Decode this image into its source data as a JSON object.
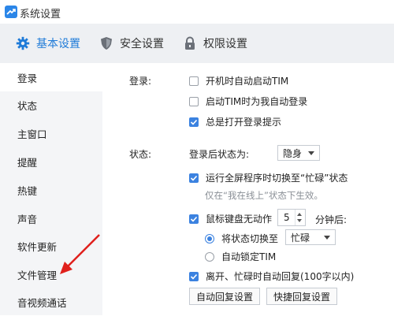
{
  "window": {
    "title": "系统设置"
  },
  "tabs": [
    {
      "label": "基本设置",
      "icon": "gear-icon",
      "active": true
    },
    {
      "label": "安全设置",
      "icon": "shield-icon",
      "active": false
    },
    {
      "label": "权限设置",
      "icon": "lock-icon",
      "active": false
    }
  ],
  "sidebar": {
    "items": [
      {
        "label": "登录",
        "active": true
      },
      {
        "label": "状态"
      },
      {
        "label": "主窗口"
      },
      {
        "label": "提醒"
      },
      {
        "label": "热键"
      },
      {
        "label": "声音"
      },
      {
        "label": "软件更新"
      },
      {
        "label": "文件管理"
      },
      {
        "label": "音视频通话"
      }
    ]
  },
  "login": {
    "label": "登录:",
    "options": [
      {
        "label": "开机时自动启动TIM",
        "checked": false
      },
      {
        "label": "启动TIM时为我自动登录",
        "checked": false
      },
      {
        "label": "总是打开登录提示",
        "checked": true
      }
    ]
  },
  "status": {
    "label": "状态:",
    "after_login_label": "登录后状态为:",
    "after_login_value": "隐身",
    "fullscreen_option": {
      "label": "运行全屏程序时切换至“忙碌”状态",
      "checked": true
    },
    "fullscreen_note": "仅在“我在线上”状态下生效。",
    "idle_option": {
      "label": "鼠标键盘无动作",
      "checked": true
    },
    "idle_minutes": "5",
    "idle_unit": "分钟后:",
    "switch_radio": {
      "label": "将状态切换至",
      "checked": true
    },
    "switch_value": "忙碌",
    "autolock_radio": {
      "label": "自动锁定TIM",
      "checked": false
    },
    "auto_reply_option": {
      "label": "离开、忙碌时自动回复(100字以内)",
      "checked": true
    },
    "buttons": {
      "auto_reply_settings": "自动回复设置",
      "quick_reply_settings": "快捷回复设置"
    }
  },
  "colors": {
    "accent": "#1f7bd8",
    "checkbox": "#3b82e0",
    "annotation_arrow": "#e0201c"
  }
}
